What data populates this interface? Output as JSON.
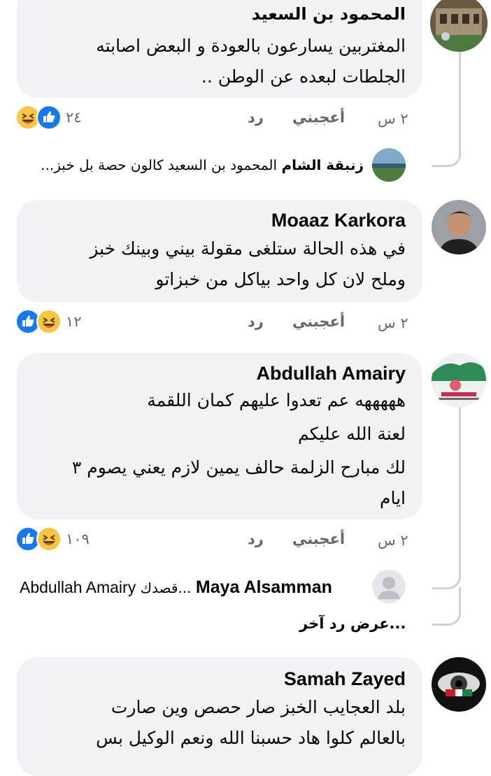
{
  "comments": [
    {
      "author": "المحمود بن السعيد",
      "lines": [
        "المغتربين يسارعون بالعودة و البعض اصابته",
        "الجلطات لبعده عن الوطن .."
      ],
      "time": "٢ س",
      "like_label": "أعجبني",
      "reply_label": "رد",
      "reaction_count": "٢٤",
      "reply_preview": {
        "author": "زنبقة الشام",
        "text": "المحمود بن السعيد كالون حصة بل خبز..."
      }
    },
    {
      "author": "Moaaz Karkora",
      "lines": [
        "في هذه الحالة ستلغى مقولة بيني وبينك خبز",
        "وملح لان كل واحد بياكل من خبزاتو"
      ],
      "time": "٢ س",
      "like_label": "أعجبني",
      "reply_label": "رد",
      "reaction_count": "١٢"
    },
    {
      "author": "Abdullah Amairy",
      "lines": [
        "هههههه عم تعدوا عليهم كمان اللقمة",
        "لعنة الله عليكم",
        "لك مبارح الزلمة حالف يمين لازم يعني يصوم ٣",
        "ايام"
      ],
      "time": "٢ س",
      "like_label": "أعجبني",
      "reply_label": "رد",
      "reaction_count": "١٠٩",
      "reply_preview": {
        "author": "Maya Alsamman",
        "text": "قصدك...",
        "mention": "Abdullah Amairy"
      },
      "more_replies": "عرض رد آخر..."
    },
    {
      "author": "Samah Zayed",
      "lines": [
        "بلد العجايب الخبز صار حصص وين صارت",
        "بالعالم كلوا هاد حسبنا الله ونعم الوكيل بس"
      ]
    }
  ],
  "colors": {
    "bubble": "#f0f2f5",
    "like": "#1877f2",
    "haha": "#f7c744",
    "meta": "#65676b",
    "thread": "#ced0d4"
  }
}
